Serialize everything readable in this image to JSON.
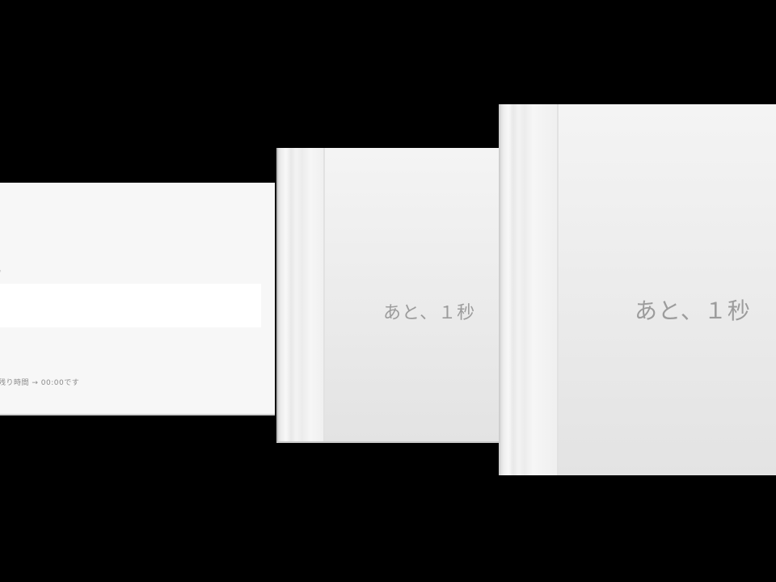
{
  "left_dialog": {
    "field_label": "。",
    "field_value": "",
    "footnote": "残り時間 → 00:00です"
  },
  "cards": [
    {
      "countdown": "あと、１秒"
    },
    {
      "countdown": "あと、１秒"
    }
  ],
  "colors": {
    "background": "#000000",
    "panel": "#f7f7f7",
    "card": "#ececec",
    "countdown_text": "#9c9c9c"
  }
}
